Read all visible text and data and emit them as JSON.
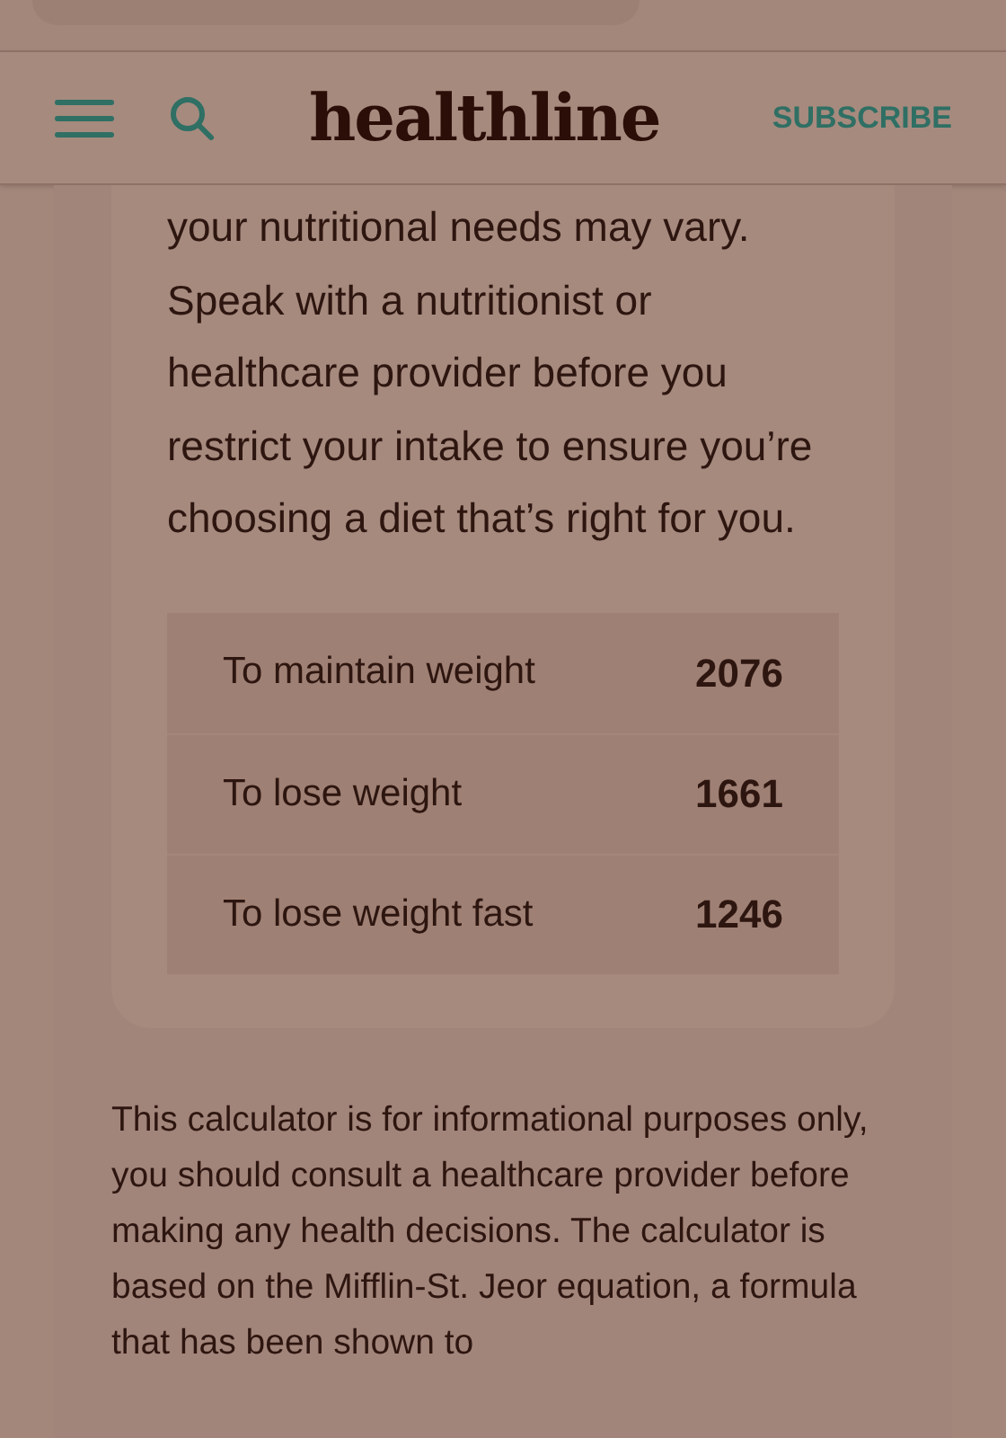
{
  "header": {
    "logo": "healthline",
    "subscribe": "SUBSCRIBE"
  },
  "card": {
    "text": "your nutritional needs may vary. Speak with a nutritionist or healthcare provider before you restrict your intake to ensure you’re choosing a diet that’s right for you.",
    "results": [
      {
        "label": "To maintain weight",
        "value": "2076"
      },
      {
        "label": "To lose weight",
        "value": "1661"
      },
      {
        "label": "To lose weight fast",
        "value": "1246"
      }
    ]
  },
  "disclaimer": "This calculator is for informational purposes only, you should consult a healthcare provider before making any health decisions. The calculator is based on the Mifflin-St. Jeor equation, a formula that has been shown to"
}
